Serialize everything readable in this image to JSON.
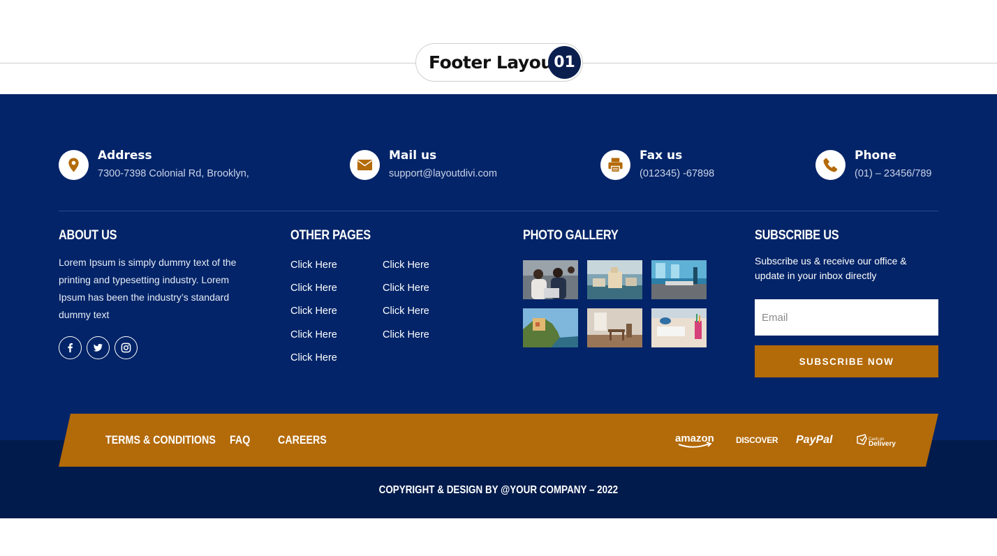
{
  "header": {
    "title": "Footer Layout",
    "number": "01"
  },
  "contacts": [
    {
      "label": "Address",
      "value": "7300-7398 Colonial Rd, Brooklyn,",
      "icon": "map-pin-icon"
    },
    {
      "label": "Mail us",
      "value": "support@layoutdivi.com",
      "icon": "envelope-icon"
    },
    {
      "label": "Fax us",
      "value": "(012345) -67898",
      "icon": "fax-icon"
    },
    {
      "label": "Phone",
      "value": "(01) – 23456/789",
      "icon": "phone-icon"
    }
  ],
  "about": {
    "title": "ABOUT US",
    "text": "Lorem Ipsum is simply dummy text of the printing and typesetting industry. Lorem Ipsum has been the industry’s standard dummy text",
    "social": [
      "facebook-icon",
      "twitter-icon",
      "instagram-icon"
    ]
  },
  "other_pages": {
    "title": "OTHER PAGES",
    "links": [
      "Click Here",
      "Click Here",
      "Click Here",
      "Click Here",
      "Click Here",
      "Click Here",
      "Click Here",
      "Click Here",
      "Click Here"
    ]
  },
  "gallery": {
    "title": "PHOTO GALLERY"
  },
  "subscribe": {
    "title": "SUBSCRIBE US",
    "text": "Subscribe us & receive our office & update in your inbox directly",
    "email_placeholder": "Email",
    "button": "SUBSCRIBE NOW"
  },
  "bottom_bar": {
    "links": [
      "TERMS & CONDITIONS",
      "FAQ",
      "CAREERS"
    ],
    "payments": [
      "amazon",
      "DISCOVER",
      "PayPal",
      "Cash on",
      "Delivery"
    ]
  },
  "copyright": "COPYRIGHT & DESIGN BY @YOUR COMPANY – 2022",
  "colors": {
    "navy": "#032468",
    "navy_dark": "#021b4d",
    "accent": "#b36a08"
  }
}
